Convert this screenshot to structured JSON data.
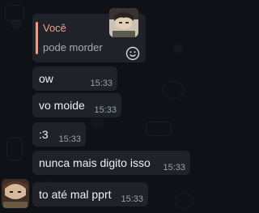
{
  "quoted_message": {
    "author": "Você",
    "text": "pode morder"
  },
  "messages": [
    {
      "text": "ow",
      "time": "15:33"
    },
    {
      "text": "vo moide",
      "time": "15:33"
    },
    {
      "text": ":3",
      "time": "15:33"
    },
    {
      "text": "nunca mais digito isso",
      "time": "15:33"
    },
    {
      "text": "to até mal pprt",
      "time": "15:33"
    }
  ],
  "icons": {
    "reaction": "smiley-icon",
    "avatar": "profile-avatar"
  },
  "colors": {
    "background": "#0e1116",
    "bubble": "#1f2329",
    "quote_accent": "#e0a08a",
    "text": "#eef0f2",
    "timestamp": "#9aa0a6"
  }
}
